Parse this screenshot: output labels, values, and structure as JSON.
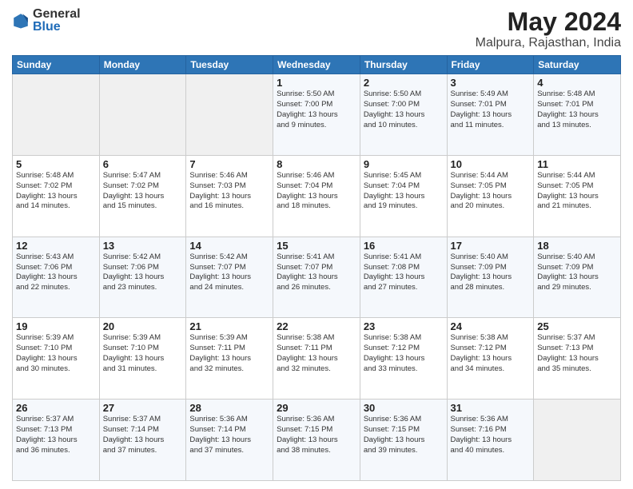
{
  "header": {
    "logo_general": "General",
    "logo_blue": "Blue",
    "title": "May 2024",
    "subtitle": "Malpura, Rajasthan, India"
  },
  "weekdays": [
    "Sunday",
    "Monday",
    "Tuesday",
    "Wednesday",
    "Thursday",
    "Friday",
    "Saturday"
  ],
  "weeks": [
    [
      {
        "day": "",
        "info": ""
      },
      {
        "day": "",
        "info": ""
      },
      {
        "day": "",
        "info": ""
      },
      {
        "day": "1",
        "info": "Sunrise: 5:50 AM\nSunset: 7:00 PM\nDaylight: 13 hours\nand 9 minutes."
      },
      {
        "day": "2",
        "info": "Sunrise: 5:50 AM\nSunset: 7:00 PM\nDaylight: 13 hours\nand 10 minutes."
      },
      {
        "day": "3",
        "info": "Sunrise: 5:49 AM\nSunset: 7:01 PM\nDaylight: 13 hours\nand 11 minutes."
      },
      {
        "day": "4",
        "info": "Sunrise: 5:48 AM\nSunset: 7:01 PM\nDaylight: 13 hours\nand 13 minutes."
      }
    ],
    [
      {
        "day": "5",
        "info": "Sunrise: 5:48 AM\nSunset: 7:02 PM\nDaylight: 13 hours\nand 14 minutes."
      },
      {
        "day": "6",
        "info": "Sunrise: 5:47 AM\nSunset: 7:02 PM\nDaylight: 13 hours\nand 15 minutes."
      },
      {
        "day": "7",
        "info": "Sunrise: 5:46 AM\nSunset: 7:03 PM\nDaylight: 13 hours\nand 16 minutes."
      },
      {
        "day": "8",
        "info": "Sunrise: 5:46 AM\nSunset: 7:04 PM\nDaylight: 13 hours\nand 18 minutes."
      },
      {
        "day": "9",
        "info": "Sunrise: 5:45 AM\nSunset: 7:04 PM\nDaylight: 13 hours\nand 19 minutes."
      },
      {
        "day": "10",
        "info": "Sunrise: 5:44 AM\nSunset: 7:05 PM\nDaylight: 13 hours\nand 20 minutes."
      },
      {
        "day": "11",
        "info": "Sunrise: 5:44 AM\nSunset: 7:05 PM\nDaylight: 13 hours\nand 21 minutes."
      }
    ],
    [
      {
        "day": "12",
        "info": "Sunrise: 5:43 AM\nSunset: 7:06 PM\nDaylight: 13 hours\nand 22 minutes."
      },
      {
        "day": "13",
        "info": "Sunrise: 5:42 AM\nSunset: 7:06 PM\nDaylight: 13 hours\nand 23 minutes."
      },
      {
        "day": "14",
        "info": "Sunrise: 5:42 AM\nSunset: 7:07 PM\nDaylight: 13 hours\nand 24 minutes."
      },
      {
        "day": "15",
        "info": "Sunrise: 5:41 AM\nSunset: 7:07 PM\nDaylight: 13 hours\nand 26 minutes."
      },
      {
        "day": "16",
        "info": "Sunrise: 5:41 AM\nSunset: 7:08 PM\nDaylight: 13 hours\nand 27 minutes."
      },
      {
        "day": "17",
        "info": "Sunrise: 5:40 AM\nSunset: 7:09 PM\nDaylight: 13 hours\nand 28 minutes."
      },
      {
        "day": "18",
        "info": "Sunrise: 5:40 AM\nSunset: 7:09 PM\nDaylight: 13 hours\nand 29 minutes."
      }
    ],
    [
      {
        "day": "19",
        "info": "Sunrise: 5:39 AM\nSunset: 7:10 PM\nDaylight: 13 hours\nand 30 minutes."
      },
      {
        "day": "20",
        "info": "Sunrise: 5:39 AM\nSunset: 7:10 PM\nDaylight: 13 hours\nand 31 minutes."
      },
      {
        "day": "21",
        "info": "Sunrise: 5:39 AM\nSunset: 7:11 PM\nDaylight: 13 hours\nand 32 minutes."
      },
      {
        "day": "22",
        "info": "Sunrise: 5:38 AM\nSunset: 7:11 PM\nDaylight: 13 hours\nand 32 minutes."
      },
      {
        "day": "23",
        "info": "Sunrise: 5:38 AM\nSunset: 7:12 PM\nDaylight: 13 hours\nand 33 minutes."
      },
      {
        "day": "24",
        "info": "Sunrise: 5:38 AM\nSunset: 7:12 PM\nDaylight: 13 hours\nand 34 minutes."
      },
      {
        "day": "25",
        "info": "Sunrise: 5:37 AM\nSunset: 7:13 PM\nDaylight: 13 hours\nand 35 minutes."
      }
    ],
    [
      {
        "day": "26",
        "info": "Sunrise: 5:37 AM\nSunset: 7:13 PM\nDaylight: 13 hours\nand 36 minutes."
      },
      {
        "day": "27",
        "info": "Sunrise: 5:37 AM\nSunset: 7:14 PM\nDaylight: 13 hours\nand 37 minutes."
      },
      {
        "day": "28",
        "info": "Sunrise: 5:36 AM\nSunset: 7:14 PM\nDaylight: 13 hours\nand 37 minutes."
      },
      {
        "day": "29",
        "info": "Sunrise: 5:36 AM\nSunset: 7:15 PM\nDaylight: 13 hours\nand 38 minutes."
      },
      {
        "day": "30",
        "info": "Sunrise: 5:36 AM\nSunset: 7:15 PM\nDaylight: 13 hours\nand 39 minutes."
      },
      {
        "day": "31",
        "info": "Sunrise: 5:36 AM\nSunset: 7:16 PM\nDaylight: 13 hours\nand 40 minutes."
      },
      {
        "day": "",
        "info": ""
      }
    ]
  ]
}
